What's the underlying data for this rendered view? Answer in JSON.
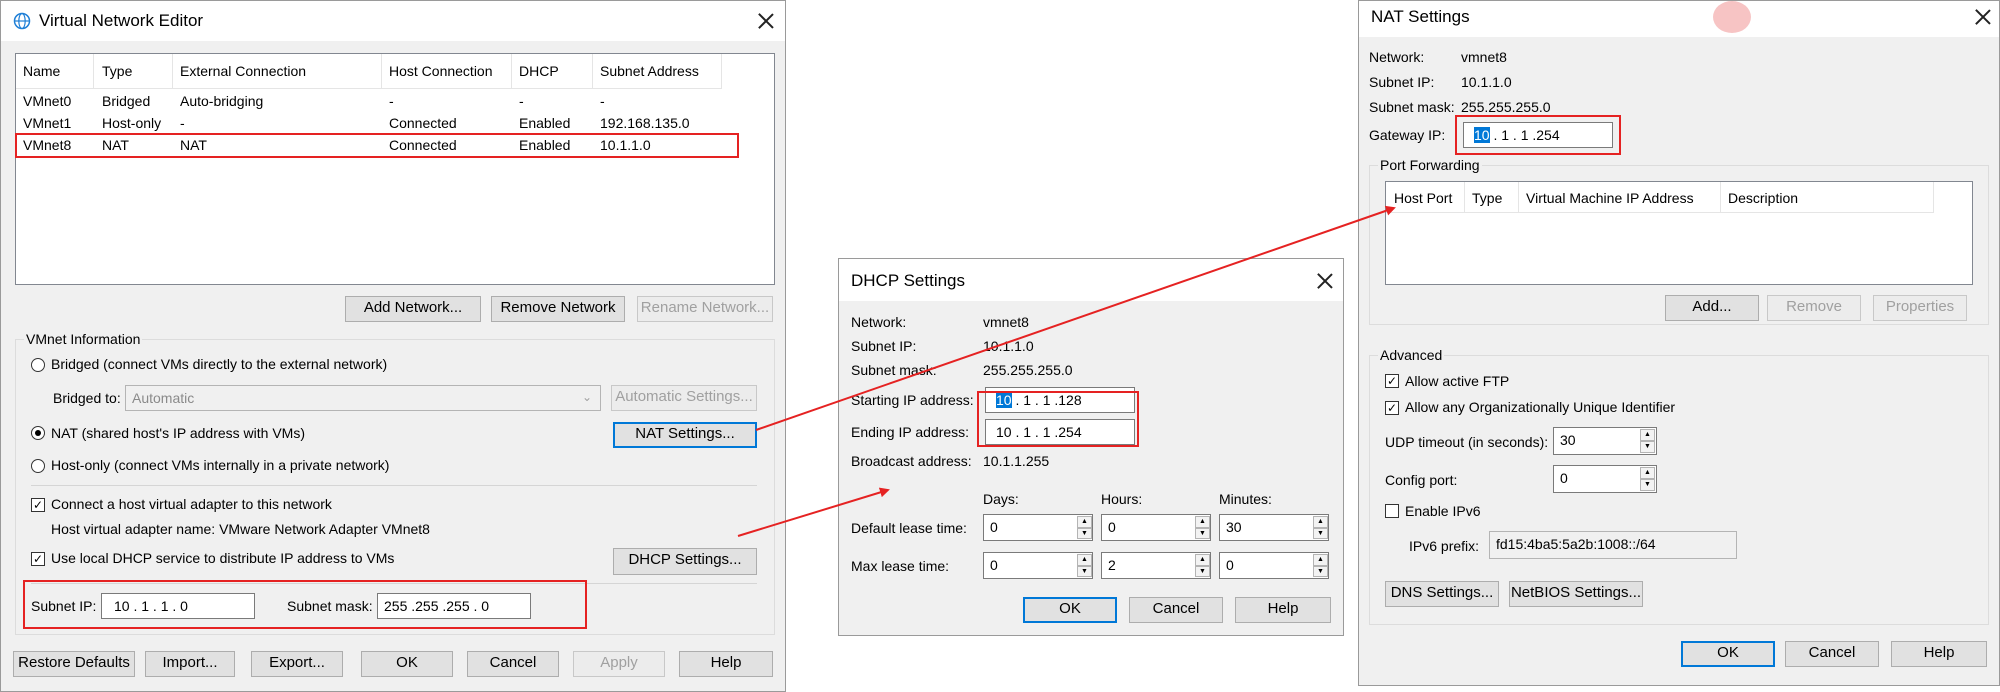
{
  "vne": {
    "title": "Virtual Network Editor",
    "columns": [
      "Name",
      "Type",
      "External Connection",
      "Host Connection",
      "DHCP",
      "Subnet Address"
    ],
    "rows": [
      [
        "VMnet0",
        "Bridged",
        "Auto-bridging",
        "-",
        "-",
        "-"
      ],
      [
        "VMnet1",
        "Host-only",
        "-",
        "Connected",
        "Enabled",
        "192.168.135.0"
      ],
      [
        "VMnet8",
        "NAT",
        "NAT",
        "Connected",
        "Enabled",
        "10.1.1.0"
      ]
    ],
    "add_network": "Add Network...",
    "remove_network": "Remove Network",
    "rename_network": "Rename Network...",
    "info_group": "VMnet Information",
    "bridged_label": "Bridged (connect VMs directly to the external network)",
    "bridged_to_label": "Bridged to:",
    "bridged_to_value": "Automatic",
    "auto_settings": "Automatic Settings...",
    "nat_label": "NAT (shared host's IP address with VMs)",
    "nat_settings": "NAT Settings...",
    "hostonly_label": "Host-only (connect VMs internally in a private network)",
    "connect_adapter": "Connect a host virtual adapter to this network",
    "adapter_name": "Host virtual adapter name: VMware Network Adapter VMnet8",
    "use_dhcp": "Use local DHCP service to distribute IP address to VMs",
    "dhcp_settings": "DHCP Settings...",
    "subnet_ip_label": "Subnet IP:",
    "subnet_ip": "10 . 1 . 1 . 0",
    "subnet_mask_label": "Subnet mask:",
    "subnet_mask": "255 .255 .255 . 0",
    "restore": "Restore Defaults",
    "import": "Import...",
    "export": "Export...",
    "ok": "OK",
    "cancel": "Cancel",
    "apply": "Apply",
    "help": "Help"
  },
  "dhcp": {
    "title": "DHCP Settings",
    "network_label": "Network:",
    "network": "vmnet8",
    "subnet_ip_label": "Subnet IP:",
    "subnet_ip": "10.1.1.0",
    "subnet_mask_label": "Subnet mask:",
    "subnet_mask": "255.255.255.0",
    "start_label": "Starting IP address:",
    "start_sel": "10",
    "start_rest": " .  1  .  1  .128",
    "end_label": "Ending IP address:",
    "end": "10  .  1  .  1  .254",
    "broadcast_label": "Broadcast address:",
    "broadcast": "10.1.1.255",
    "days": "Days:",
    "hours": "Hours:",
    "minutes": "Minutes:",
    "default_lease": "Default lease time:",
    "default_days": "0",
    "default_hours": "0",
    "default_minutes": "30",
    "max_lease": "Max lease time:",
    "max_days": "0",
    "max_hours": "2",
    "max_minutes": "0",
    "ok": "OK",
    "cancel": "Cancel",
    "help": "Help"
  },
  "nat": {
    "title": "NAT Settings",
    "network_label": "Network:",
    "network": "vmnet8",
    "subnet_ip_label": "Subnet IP:",
    "subnet_ip": "10.1.1.0",
    "subnet_mask_label": "Subnet mask:",
    "subnet_mask": "255.255.255.0",
    "gateway_label": "Gateway IP:",
    "gateway_sel": "10",
    "gateway_rest": " .  1  .  1  .254",
    "port_forwarding": "Port Forwarding",
    "pf_columns": [
      "Host Port",
      "Type",
      "Virtual Machine IP Address",
      "Description"
    ],
    "add": "Add...",
    "remove": "Remove",
    "properties": "Properties",
    "advanced": "Advanced",
    "allow_ftp": "Allow active FTP",
    "allow_oui": "Allow any Organizationally Unique Identifier",
    "udp_label": "UDP timeout (in seconds):",
    "udp": "30",
    "config_port_label": "Config port:",
    "config_port": "0",
    "enable_ipv6": "Enable IPv6",
    "ipv6_prefix_label": "IPv6 prefix:",
    "ipv6_prefix": "fd15:4ba5:5a2b:1008::/64",
    "dns_settings": "DNS Settings...",
    "netbios_settings": "NetBIOS Settings...",
    "ok": "OK",
    "cancel": "Cancel",
    "help": "Help"
  },
  "colors": {
    "annotation": "#e52222",
    "accent": "#0078d7"
  }
}
